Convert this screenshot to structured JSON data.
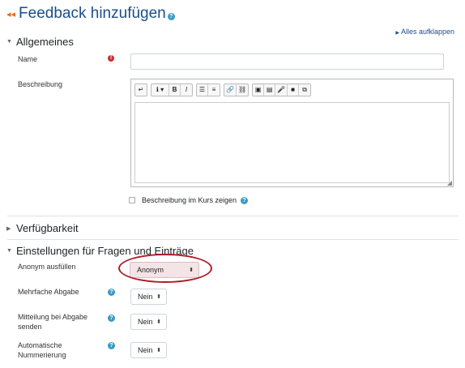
{
  "page_title": "Feedback hinzufügen",
  "expand_all": "Alles aufklappen",
  "sections": {
    "general": "Allgemeines",
    "availability": "Verfügbarkeit",
    "question_settings": "Einstellungen für Fragen und Einträge"
  },
  "general": {
    "name_label": "Name",
    "name_value": "",
    "description_label": "Beschreibung",
    "show_description_label": "Beschreibung im Kurs zeigen"
  },
  "editor_toolbar": {
    "groups": [
      [
        "↵"
      ],
      [
        "ℹ ▾",
        "B",
        "I"
      ],
      [
        "☰",
        "≡"
      ],
      [
        "🔗",
        "⛓"
      ],
      [
        "▣",
        "▤",
        "🎤",
        "■",
        "⧉"
      ]
    ]
  },
  "question_settings": {
    "anonymous_label": "Anonym ausfüllen",
    "anonymous_value": "Anonym",
    "multiple_label": "Mehrfache Abgabe",
    "multiple_value": "Nein",
    "notify_label": "Mitteilung bei Abgabe senden",
    "notify_value": "Nein",
    "autonumber_label": "Automatische Nummerierung",
    "autonumber_value": "Nein"
  },
  "colors": {
    "heading": "#1a4e8a",
    "help_icon": "#3a9bc4",
    "required_icon": "#c9302c",
    "highlight_ring": "#b01c2a"
  }
}
